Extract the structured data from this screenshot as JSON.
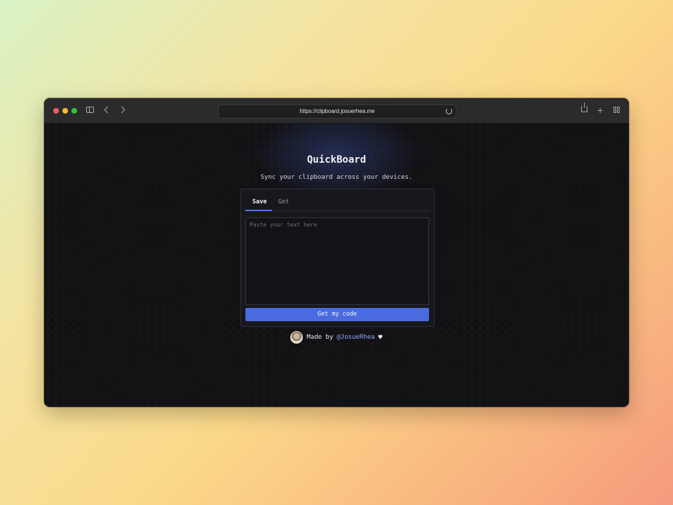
{
  "browser": {
    "url": "https://clipboard.josuerhea.me"
  },
  "page": {
    "title": "QuickBoard",
    "subtitle": "Sync your clipboard across your devices.",
    "tabs": [
      {
        "label": "Save",
        "active": true
      },
      {
        "label": "Get",
        "active": false
      }
    ],
    "textarea_placeholder": "Paste your text here",
    "button_label": "Get my code",
    "footer": {
      "prefix": "Made by",
      "handle": "@JosueRhea",
      "heart": "♥"
    }
  },
  "colors": {
    "accent": "#4b6ae0",
    "link": "#8ea6ff",
    "background": "#121215"
  }
}
